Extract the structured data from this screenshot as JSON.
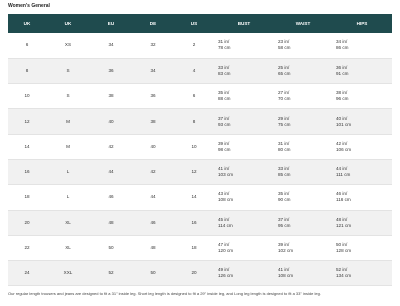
{
  "title": "Women's General",
  "headers": [
    "UK",
    "UK",
    "EU",
    "DE",
    "US",
    "BUST",
    "WAIST",
    "HIPS"
  ],
  "rows": [
    {
      "uk_num": "6",
      "uk_size": "XS",
      "eu": "34",
      "de": "32",
      "us": "2",
      "bust_in": "31 in/",
      "bust_cm": "78 cm",
      "waist_in": "23 in/",
      "waist_cm": "58 cm",
      "hips_in": "34 in/",
      "hips_cm": "86 cm"
    },
    {
      "uk_num": "8",
      "uk_size": "S",
      "eu": "36",
      "de": "34",
      "us": "4",
      "bust_in": "33 in/",
      "bust_cm": "83 cm",
      "waist_in": "25 in/",
      "waist_cm": "65 cm",
      "hips_in": "36 in/",
      "hips_cm": "91 cm"
    },
    {
      "uk_num": "10",
      "uk_size": "S",
      "eu": "38",
      "de": "36",
      "us": "6",
      "bust_in": "35 in/",
      "bust_cm": "88 cm",
      "waist_in": "27 in/",
      "waist_cm": "70 cm",
      "hips_in": "38 in/",
      "hips_cm": "96 cm"
    },
    {
      "uk_num": "12",
      "uk_size": "M",
      "eu": "40",
      "de": "38",
      "us": "8",
      "bust_in": "37 in/",
      "bust_cm": "93 cm",
      "waist_in": "29 in/",
      "waist_cm": "75 cm",
      "hips_in": "40 in/",
      "hips_cm": "101 cm"
    },
    {
      "uk_num": "14",
      "uk_size": "M",
      "eu": "42",
      "de": "40",
      "us": "10",
      "bust_in": "39 in/",
      "bust_cm": "98 cm",
      "waist_in": "31 in/",
      "waist_cm": "80 cm",
      "hips_in": "42 in/",
      "hips_cm": "106 cm"
    },
    {
      "uk_num": "16",
      "uk_size": "L",
      "eu": "44",
      "de": "42",
      "us": "12",
      "bust_in": "41 in/",
      "bust_cm": "103 cm",
      "waist_in": "33 in/",
      "waist_cm": "85 cm",
      "hips_in": "44 in/",
      "hips_cm": "111 cm"
    },
    {
      "uk_num": "18",
      "uk_size": "L",
      "eu": "46",
      "de": "44",
      "us": "14",
      "bust_in": "43 in/",
      "bust_cm": "108 cm",
      "waist_in": "35 in/",
      "waist_cm": "90 cm",
      "hips_in": "46 in/",
      "hips_cm": "116 cm"
    },
    {
      "uk_num": "20",
      "uk_size": "XL",
      "eu": "48",
      "de": "46",
      "us": "16",
      "bust_in": "45 in/",
      "bust_cm": "114 cm",
      "waist_in": "37 in/",
      "waist_cm": "95 cm",
      "hips_in": "48 in/",
      "hips_cm": "121 cm"
    },
    {
      "uk_num": "22",
      "uk_size": "XL",
      "eu": "50",
      "de": "48",
      "us": "18",
      "bust_in": "47 in/",
      "bust_cm": "120 cm",
      "waist_in": "39 in/",
      "waist_cm": "102 cm",
      "hips_in": "50 in/",
      "hips_cm": "128 cm"
    },
    {
      "uk_num": "24",
      "uk_size": "XXL",
      "eu": "52",
      "de": "50",
      "us": "20",
      "bust_in": "49 in/",
      "bust_cm": "126 cm",
      "waist_in": "41 in/",
      "waist_cm": "108 cm",
      "hips_in": "52 in/",
      "hips_cm": "134 cm"
    }
  ],
  "footnote": "Our regular length trousers and jeans are designed to fit a 31\" inside leg. Short leg length is designed to fit a 29\" inside leg, and Long leg length is designed to fit a 33\" inside leg.",
  "colors": {
    "header_bg": "#1f4b4e",
    "header_text": "#ffffff",
    "stripe": "#f1f1f1"
  }
}
